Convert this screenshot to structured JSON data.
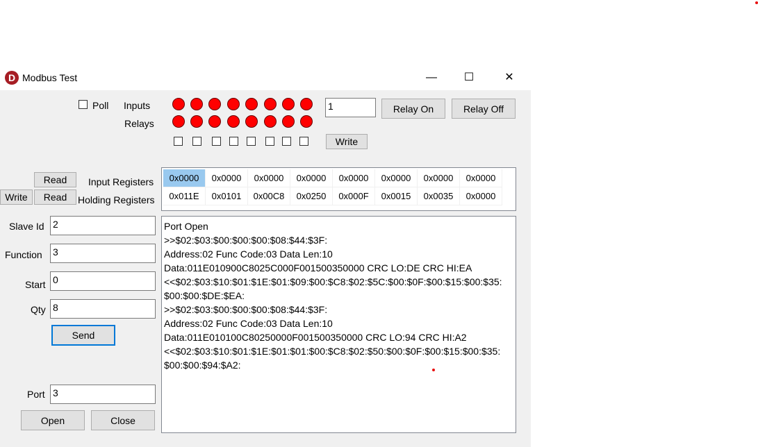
{
  "window": {
    "title": "Modbus Test",
    "icon_letter": "D",
    "icon_color": "#a61d24",
    "minimize_glyph": "—",
    "maximize_glyph": "☐",
    "close_glyph": "✕"
  },
  "top": {
    "poll_label": "Poll",
    "poll_checked": false,
    "inputs_label": "Inputs",
    "relays_label": "Relays",
    "led_color": "#ff0000",
    "relay_value": "1",
    "relay_on_label": "Relay On",
    "relay_off_label": "Relay Off",
    "write_label": "Write"
  },
  "registers": {
    "read_input_label": "Read",
    "write_holding_label": "Write",
    "read_holding_label": "Read",
    "input_label": "Input Registers",
    "holding_label": "Holding Registers",
    "input_values": [
      "0x0000",
      "0x0000",
      "0x0000",
      "0x0000",
      "0x0000",
      "0x0000",
      "0x0000",
      "0x0000"
    ],
    "holding_values": [
      "0x011E",
      "0x0101",
      "0x00C8",
      "0x0250",
      "0x000F",
      "0x0015",
      "0x0035",
      "0x0000"
    ]
  },
  "form": {
    "slave_id_label": "Slave Id",
    "slave_id_value": "2",
    "function_label": "Function",
    "function_value": "3",
    "start_label": "Start",
    "start_value": "0",
    "qty_label": "Qty",
    "qty_value": "8",
    "send_label": "Send",
    "port_label": "Port",
    "port_value": "3",
    "open_label": "Open",
    "close_label": "Close"
  },
  "log": [
    "Port Open",
    ">>$02:$03:$00:$00:$00:$08:$44:$3F:",
    "Address:02 Func Code:03 Data Len:10",
    "Data:011E010900C8025C000F001500350000 CRC LO:DE CRC HI:EA",
    "<<$02:$03:$10:$01:$1E:$01:$09:$00:$C8:$02:$5C:$00:$0F:$00:$15:$00:$35:",
    "$00:$00:$DE:$EA:",
    ">>$02:$03:$00:$00:$00:$08:$44:$3F:",
    "Address:02 Func Code:03 Data Len:10",
    "Data:011E010100C80250000F001500350000 CRC LO:94 CRC HI:A2",
    "<<$02:$03:$10:$01:$1E:$01:$01:$00:$C8:$02:$50:$00:$0F:$00:$15:$00:$35:",
    "$00:$00:$94:$A2:"
  ]
}
